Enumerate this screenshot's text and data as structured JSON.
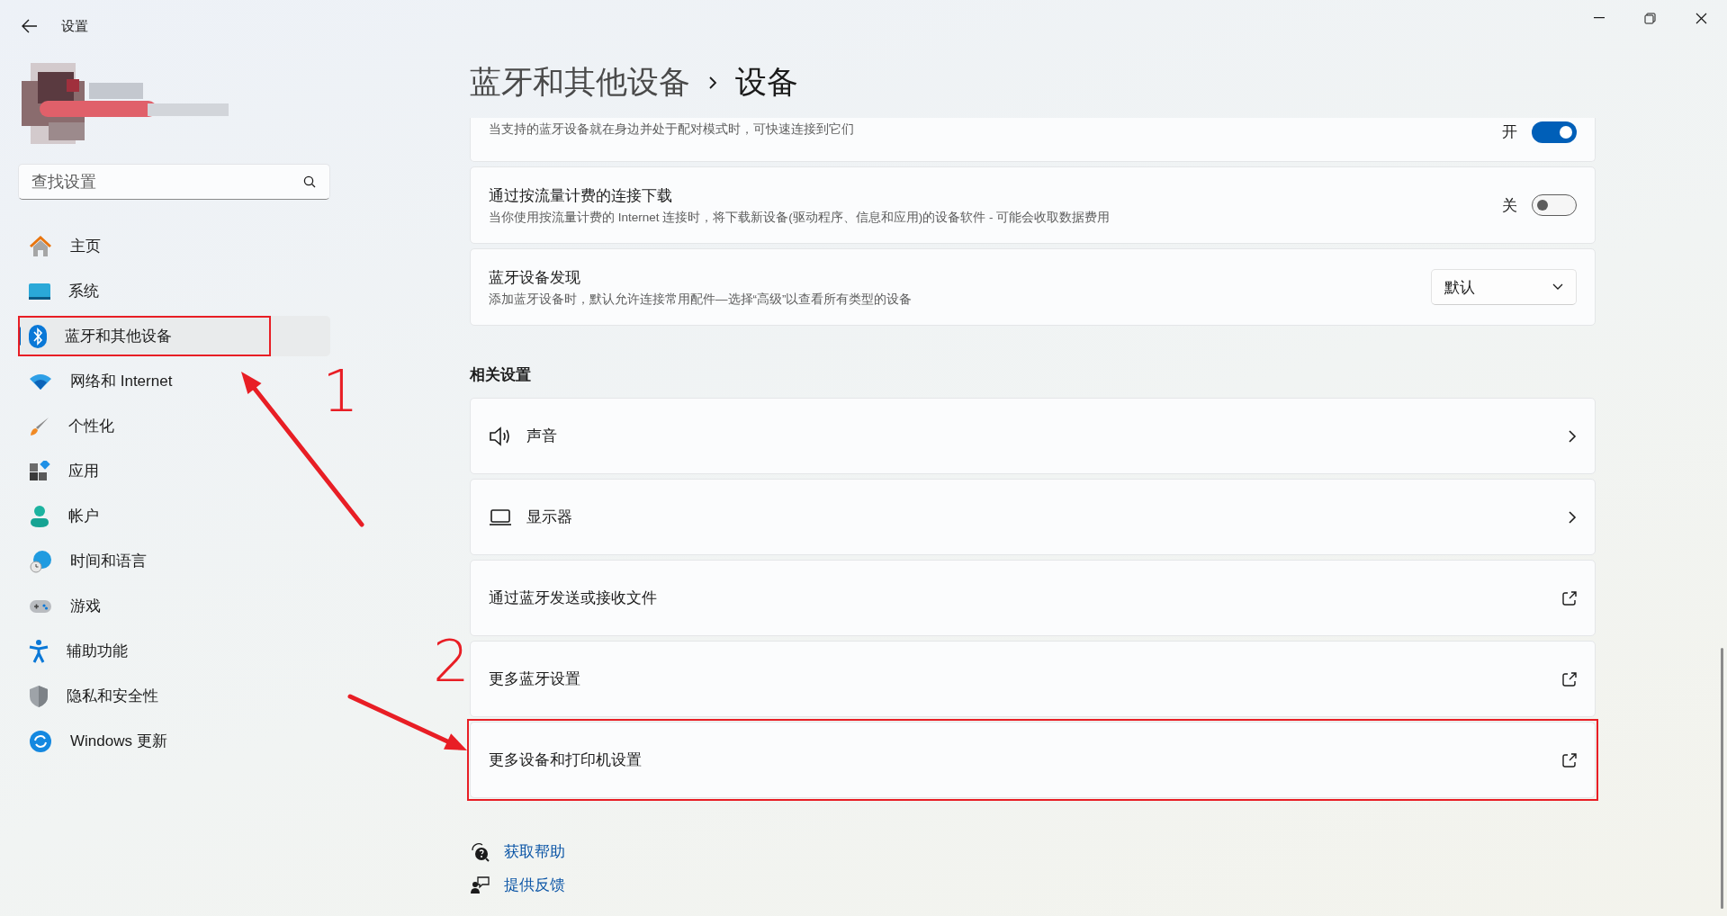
{
  "window": {
    "title": "设置"
  },
  "search": {
    "placeholder": "查找设置"
  },
  "nav": [
    {
      "label": "主页",
      "selected": false
    },
    {
      "label": "系统",
      "selected": false
    },
    {
      "label": "蓝牙和其他设备",
      "selected": true,
      "callout": "1"
    },
    {
      "label": "网络和 Internet",
      "selected": false
    },
    {
      "label": "个性化",
      "selected": false
    },
    {
      "label": "应用",
      "selected": false
    },
    {
      "label": "帐户",
      "selected": false
    },
    {
      "label": "时间和语言",
      "selected": false
    },
    {
      "label": "游戏",
      "selected": false
    },
    {
      "label": "辅助功能",
      "selected": false
    },
    {
      "label": "隐私和安全性",
      "selected": false
    },
    {
      "label": "Windows 更新",
      "selected": false
    }
  ],
  "breadcrumb": {
    "parent": "蓝牙和其他设备",
    "current": "设备"
  },
  "settings": [
    {
      "kind": "toggle",
      "description": "当支持的蓝牙设备就在身边并处于配对模式时，可快速连接到它们",
      "state_label": "开",
      "on": true
    },
    {
      "kind": "toggle",
      "title": "通过按流量计费的连接下载",
      "description": "当你使用按流量计费的 Internet 连接时，将下载新设备(驱动程序、信息和应用)的设备软件 - 可能会收取数据费用",
      "state_label": "关",
      "on": false
    },
    {
      "kind": "dropdown",
      "title": "蓝牙设备发现",
      "description": "添加蓝牙设备时，默认允许连接常用配件—选择“高级”以查看所有类型的设备",
      "value": "默认"
    }
  ],
  "related": {
    "heading": "相关设置",
    "items": [
      {
        "kind": "nav",
        "label": "声音"
      },
      {
        "kind": "nav",
        "label": "显示器"
      },
      {
        "kind": "external",
        "label": "通过蓝牙发送或接收文件"
      },
      {
        "kind": "external",
        "label": "更多蓝牙设置"
      },
      {
        "kind": "external",
        "label": "更多设备和打印机设置",
        "callout": "2"
      }
    ]
  },
  "help_links": [
    "获取帮助",
    "提供反馈"
  ]
}
